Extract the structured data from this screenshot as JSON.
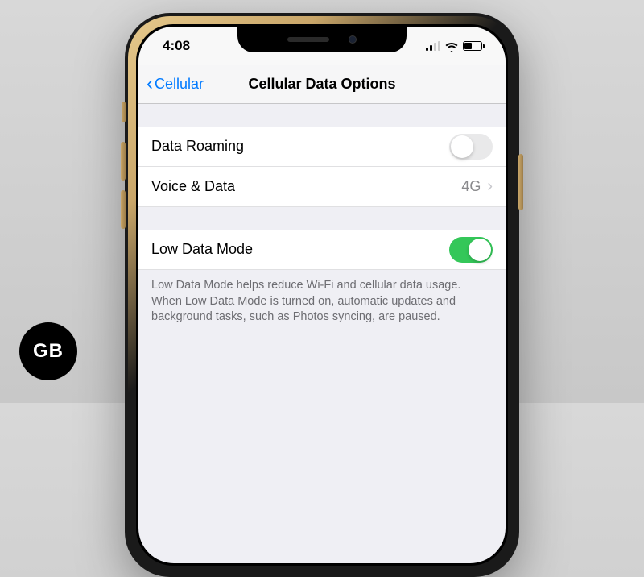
{
  "badge": {
    "label": "GB"
  },
  "statusbar": {
    "time": "4:08",
    "signal_bars_active": 2,
    "battery_percent": 40
  },
  "nav": {
    "back_label": "Cellular",
    "title": "Cellular Data Options"
  },
  "rows": {
    "data_roaming": {
      "label": "Data Roaming",
      "on": false
    },
    "voice_data": {
      "label": "Voice & Data",
      "value": "4G"
    },
    "low_data": {
      "label": "Low Data Mode",
      "on": true
    }
  },
  "footer": "Low Data Mode helps reduce Wi-Fi and cellular data usage. When Low Data Mode is turned on, automatic updates and background tasks, such as Photos syncing, are paused."
}
